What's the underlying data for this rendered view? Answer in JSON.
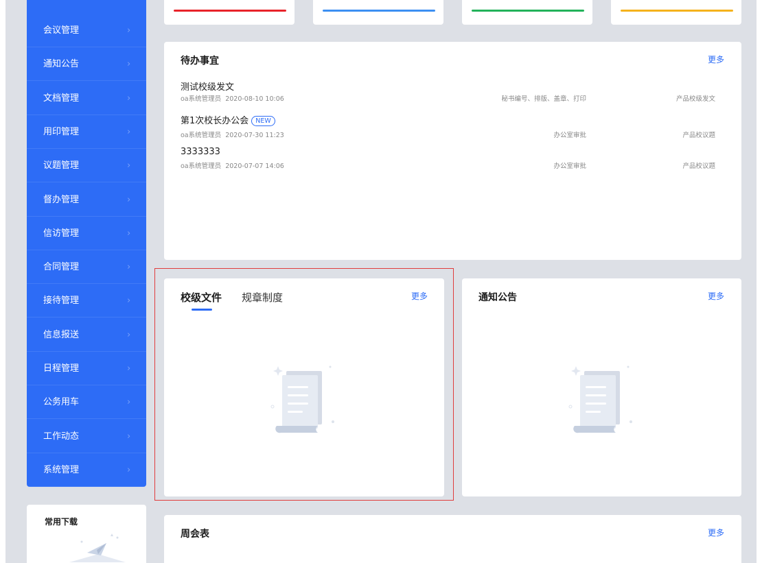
{
  "sidebar": {
    "items": [
      {
        "label": "会议管理"
      },
      {
        "label": "通知公告"
      },
      {
        "label": "文档管理"
      },
      {
        "label": "用印管理"
      },
      {
        "label": "议题管理"
      },
      {
        "label": "督办管理"
      },
      {
        "label": "信访管理"
      },
      {
        "label": "合同管理"
      },
      {
        "label": "接待管理"
      },
      {
        "label": "信息报送"
      },
      {
        "label": "日程管理"
      },
      {
        "label": "公务用车"
      },
      {
        "label": "工作动态"
      },
      {
        "label": "系统管理"
      }
    ],
    "chevron": "›"
  },
  "stat_cards": {
    "colors": [
      "#e8232a",
      "#3c8ff2",
      "#22b25a",
      "#f5b21c"
    ]
  },
  "todo": {
    "title": "待办事宜",
    "more": "更多",
    "items": [
      {
        "title": "测试校级发文",
        "author": "oa系统管理员",
        "date": "2020-08-10 10:06",
        "action": "秘书编号、排版、盖章、打印",
        "type": "产品校级发文",
        "is_new": false
      },
      {
        "title": "第1次校长办公会",
        "author": "oa系统管理员",
        "date": "2020-07-30 11:23",
        "action": "办公室审批",
        "type": "产品校议题",
        "is_new": true,
        "badge": "NEW"
      },
      {
        "title": "3333333",
        "author": "oa系统管理员",
        "date": "2020-07-07 14:06",
        "action": "办公室审批",
        "type": "产品校议题",
        "is_new": false
      }
    ]
  },
  "documents": {
    "tabs": [
      "校级文件",
      "规章制度"
    ],
    "active_tab": 0,
    "more": "更多"
  },
  "notices": {
    "title": "通知公告",
    "more": "更多"
  },
  "downloads": {
    "title": "常用下载"
  },
  "weekly": {
    "title": "周会表",
    "more": "更多"
  },
  "colors": {
    "accent": "#2d6cf6",
    "highlight": "#e03c3c",
    "background": "#dde0e6"
  }
}
